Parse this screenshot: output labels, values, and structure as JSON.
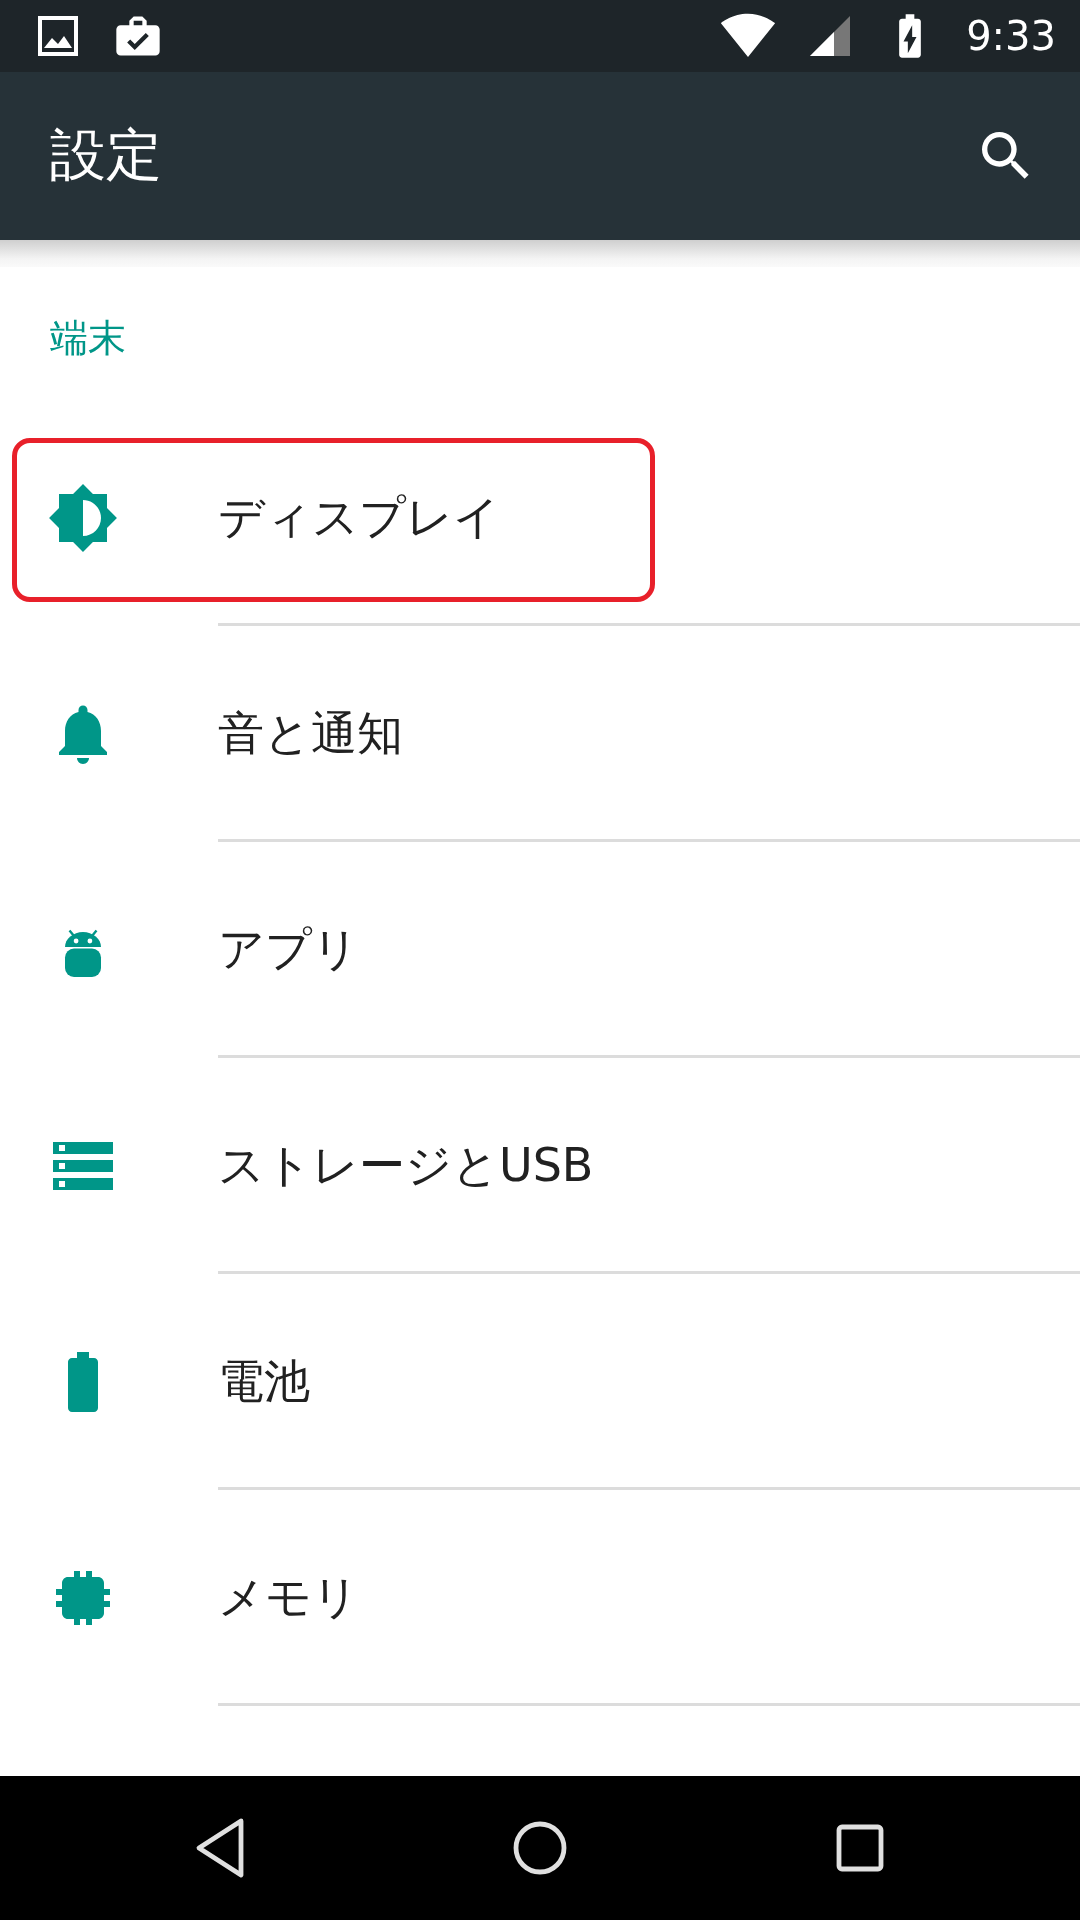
{
  "status_bar": {
    "time": "9:33"
  },
  "toolbar": {
    "title": "設定"
  },
  "section": {
    "title": "端末"
  },
  "items": [
    {
      "label": "ディスプレイ",
      "kind": "display",
      "highlighted": true
    },
    {
      "label": "音と通知",
      "kind": "sound",
      "highlighted": false
    },
    {
      "label": "アプリ",
      "kind": "apps",
      "highlighted": false
    },
    {
      "label": "ストレージとUSB",
      "kind": "storage",
      "highlighted": false
    },
    {
      "label": "電池",
      "kind": "battery",
      "highlighted": false
    },
    {
      "label": "メモリ",
      "kind": "memory",
      "highlighted": false
    }
  ]
}
